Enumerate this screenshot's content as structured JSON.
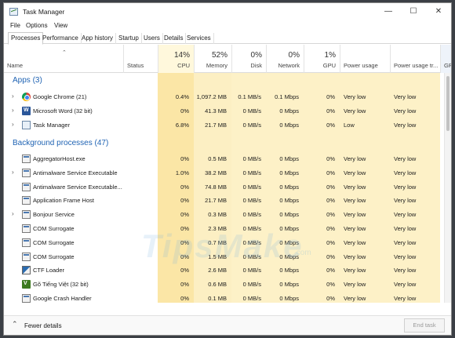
{
  "window": {
    "title": "Task Manager"
  },
  "menu": [
    "File",
    "Options",
    "View"
  ],
  "tabs": [
    "Processes",
    "Performance",
    "App history",
    "Startup",
    "Users",
    "Details",
    "Services"
  ],
  "columns": {
    "name": "Name",
    "status": "Status",
    "cpu": {
      "pct": "14%",
      "label": "CPU"
    },
    "memory": {
      "pct": "52%",
      "label": "Memory"
    },
    "disk": {
      "pct": "0%",
      "label": "Disk"
    },
    "network": {
      "pct": "0%",
      "label": "Network"
    },
    "gpu": {
      "pct": "1%",
      "label": "GPU"
    },
    "power": "Power usage",
    "power_trend": "Power usage tr...",
    "extra": "GP"
  },
  "groups": {
    "apps": "Apps (3)",
    "background": "Background processes (47)"
  },
  "apps": [
    {
      "name": "Google Chrome (21)",
      "icon": "chrome-icon",
      "cpu": "0.4%",
      "mem": "1,097.2 MB",
      "disk": "0.1 MB/s",
      "net": "0.1 Mbps",
      "gpu": "0%",
      "power": "Very low",
      "trend": "Very low"
    },
    {
      "name": "Microsoft Word (32 bit)",
      "icon": "word-icon",
      "cpu": "0%",
      "mem": "41.3 MB",
      "disk": "0 MB/s",
      "net": "0 Mbps",
      "gpu": "0%",
      "power": "Very low",
      "trend": "Very low"
    },
    {
      "name": "Task Manager",
      "icon": "task-manager-icon",
      "cpu": "6.8%",
      "mem": "21.7 MB",
      "disk": "0 MB/s",
      "net": "0 Mbps",
      "gpu": "0%",
      "power": "Low",
      "trend": "Very low"
    }
  ],
  "background": [
    {
      "name": "AggregatorHost.exe",
      "icon": "system-process-icon",
      "expand": false,
      "cpu": "0%",
      "mem": "0.5 MB",
      "disk": "0 MB/s",
      "net": "0 Mbps",
      "gpu": "0%",
      "power": "Very low",
      "trend": "Very low"
    },
    {
      "name": "Antimalware Service Executable",
      "icon": "system-process-icon",
      "expand": true,
      "cpu": "1.0%",
      "mem": "38.2 MB",
      "disk": "0 MB/s",
      "net": "0 Mbps",
      "gpu": "0%",
      "power": "Very low",
      "trend": "Very low"
    },
    {
      "name": "Antimalware Service Executable...",
      "icon": "system-process-icon",
      "expand": false,
      "cpu": "0%",
      "mem": "74.8 MB",
      "disk": "0 MB/s",
      "net": "0 Mbps",
      "gpu": "0%",
      "power": "Very low",
      "trend": "Very low"
    },
    {
      "name": "Application Frame Host",
      "icon": "system-process-icon",
      "expand": false,
      "cpu": "0%",
      "mem": "21.7 MB",
      "disk": "0 MB/s",
      "net": "0 Mbps",
      "gpu": "0%",
      "power": "Very low",
      "trend": "Very low"
    },
    {
      "name": "Bonjour Service",
      "icon": "system-process-icon",
      "expand": true,
      "cpu": "0%",
      "mem": "0.3 MB",
      "disk": "0 MB/s",
      "net": "0 Mbps",
      "gpu": "0%",
      "power": "Very low",
      "trend": "Very low"
    },
    {
      "name": "COM Surrogate",
      "icon": "system-process-icon",
      "expand": false,
      "cpu": "0%",
      "mem": "2.3 MB",
      "disk": "0 MB/s",
      "net": "0 Mbps",
      "gpu": "0%",
      "power": "Very low",
      "trend": "Very low"
    },
    {
      "name": "COM Surrogate",
      "icon": "system-process-icon",
      "expand": false,
      "cpu": "0%",
      "mem": "0.7 MB",
      "disk": "0 MB/s",
      "net": "0 Mbps",
      "gpu": "0%",
      "power": "Very low",
      "trend": "Very low"
    },
    {
      "name": "COM Surrogate",
      "icon": "system-process-icon",
      "expand": false,
      "cpu": "0%",
      "mem": "1.5 MB",
      "disk": "0 MB/s",
      "net": "0 Mbps",
      "gpu": "0%",
      "power": "Very low",
      "trend": "Very low"
    },
    {
      "name": "CTF Loader",
      "icon": "ctf-loader-icon",
      "expand": false,
      "cpu": "0%",
      "mem": "2.6 MB",
      "disk": "0 MB/s",
      "net": "0 Mbps",
      "gpu": "0%",
      "power": "Very low",
      "trend": "Very low"
    },
    {
      "name": "Gõ Tiếng Việt (32 bit)",
      "icon": "go-tieng-viet-icon",
      "expand": false,
      "cpu": "0%",
      "mem": "0.6 MB",
      "disk": "0 MB/s",
      "net": "0 Mbps",
      "gpu": "0%",
      "power": "Very low",
      "trend": "Very low"
    },
    {
      "name": "Google Crash Handler",
      "icon": "system-process-icon",
      "expand": false,
      "cpu": "0%",
      "mem": "0.1 MB",
      "disk": "0 MB/s",
      "net": "0 Mbps",
      "gpu": "0%",
      "power": "Very low",
      "trend": "Very low"
    }
  ],
  "footer": {
    "fewer": "Fewer details",
    "end_task": "End task"
  },
  "watermark": {
    "text": "TipsMake",
    "sub": ".com"
  }
}
